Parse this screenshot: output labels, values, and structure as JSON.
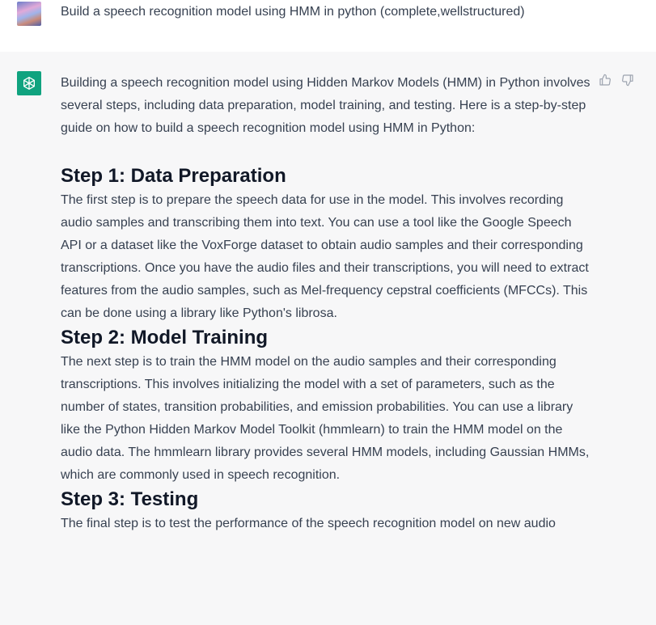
{
  "user_message": {
    "text": "Build a speech recognition model using HMM in python (complete,wellstructured)"
  },
  "assistant_message": {
    "intro": "Building a speech recognition model using Hidden Markov Models (HMM) in Python involves several steps, including data preparation, model training, and testing. Here is a step-by-step guide on how to build a speech recognition model using HMM in Python:",
    "steps": [
      {
        "heading": "Step 1: Data Preparation",
        "body": "The first step is to prepare the speech data for use in the model. This involves recording audio samples and transcribing them into text. You can use a tool like the Google Speech API or a dataset like the VoxForge dataset to obtain audio samples and their corresponding transcriptions. Once you have the audio files and their transcriptions, you will need to extract features from the audio samples, such as Mel-frequency cepstral coefficients (MFCCs). This can be done using a library like Python's librosa."
      },
      {
        "heading": "Step 2: Model Training",
        "body": "The next step is to train the HMM model on the audio samples and their corresponding transcriptions. This involves initializing the model with a set of parameters, such as the number of states, transition probabilities, and emission probabilities. You can use a library like the Python Hidden Markov Model Toolkit (hmmlearn) to train the HMM model on the audio data. The hmmlearn library provides several HMM models, including Gaussian HMMs, which are commonly used in speech recognition."
      },
      {
        "heading": "Step 3: Testing",
        "body": "The final step is to test the performance of the speech recognition model on new audio"
      }
    ]
  },
  "icons": {
    "user_avatar": "user-avatar-image",
    "assistant_avatar": "openai-logo-icon",
    "thumbs_up": "thumbs-up-icon",
    "thumbs_down": "thumbs-down-icon"
  },
  "colors": {
    "assistant_bg": "#f7f7f8",
    "user_bg": "#ffffff",
    "brand_green": "#10a37f",
    "text": "#374151"
  }
}
